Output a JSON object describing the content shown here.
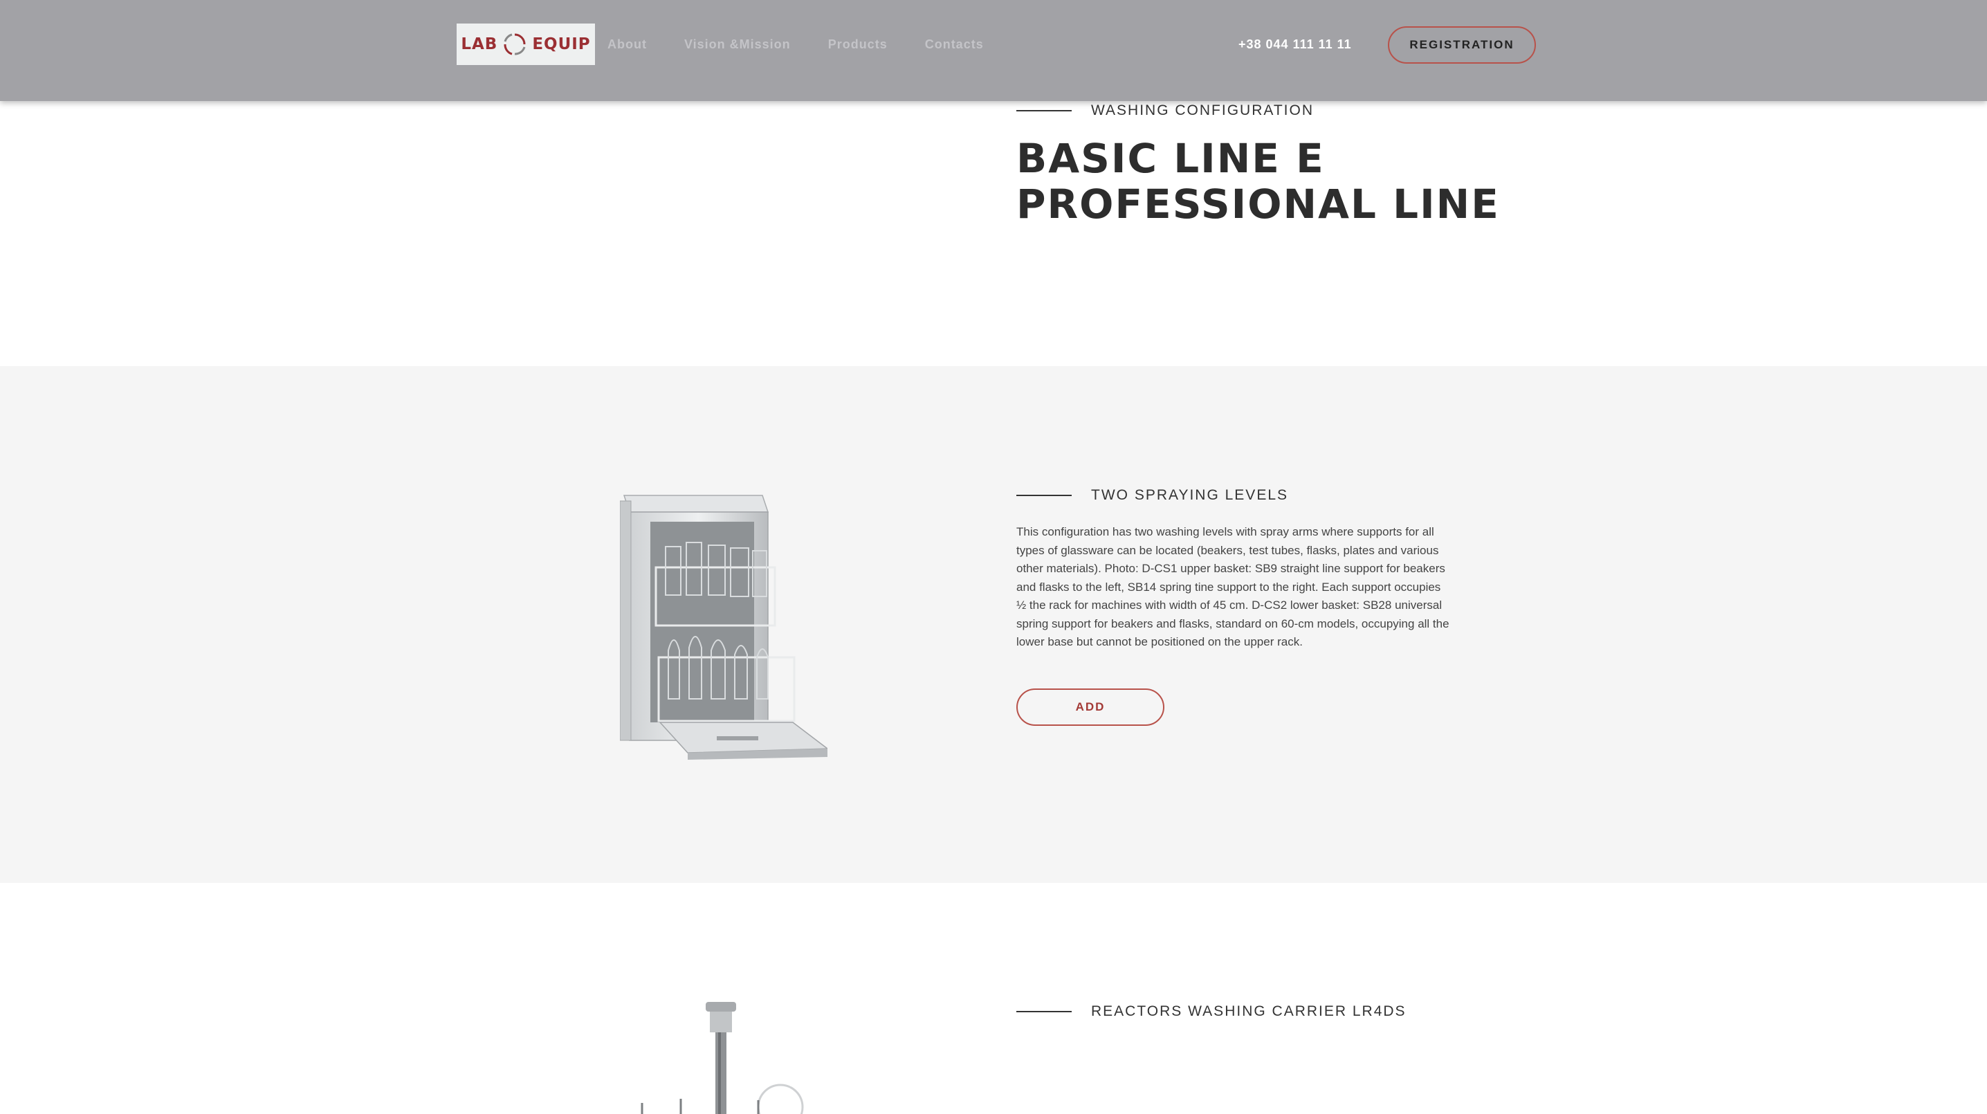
{
  "header": {
    "logo_left": "LAB",
    "logo_right": "EQUIP",
    "nav": [
      "About",
      "Vision &Mission",
      "Products",
      "Contacts"
    ],
    "phone": "+38 044 111 11 11",
    "registration_label": "REGISTRATION"
  },
  "hero": {
    "eyebrow": "WASHING CONFIGURATION",
    "title_line1": "BASIC LINE E",
    "title_line2": "PROFESSIONAL LINE"
  },
  "feature": {
    "eyebrow": "TWO SPRAYING LEVELS",
    "description": "This configuration has two washing levels with spray arms where supports for all types of glassware can be located (beakers, test tubes, flasks, plates and various other materials). Photo: D-CS1 upper basket: SB9 straight line support for beakers and flasks to the left, SB14 spring tine support to the right. Each support occupies ½ the rack for machines with width of 45 cm. D-CS2 lower basket: SB28 universal spring support for beakers and flasks, standard on 60-cm models, occupying all the lower base but cannot be positioned on the upper rack.",
    "add_label": "ADD"
  },
  "next": {
    "eyebrow": "REACTORS WASHING CARRIER LR4DS"
  },
  "colors": {
    "header_bg": "#a2a2a6",
    "accent": "#b8524a",
    "brand": "#9b2f33",
    "section_gray": "#f5f5f5"
  },
  "icons": [
    "logo-ring-icon",
    "dishwasher-image",
    "carrier-image"
  ]
}
